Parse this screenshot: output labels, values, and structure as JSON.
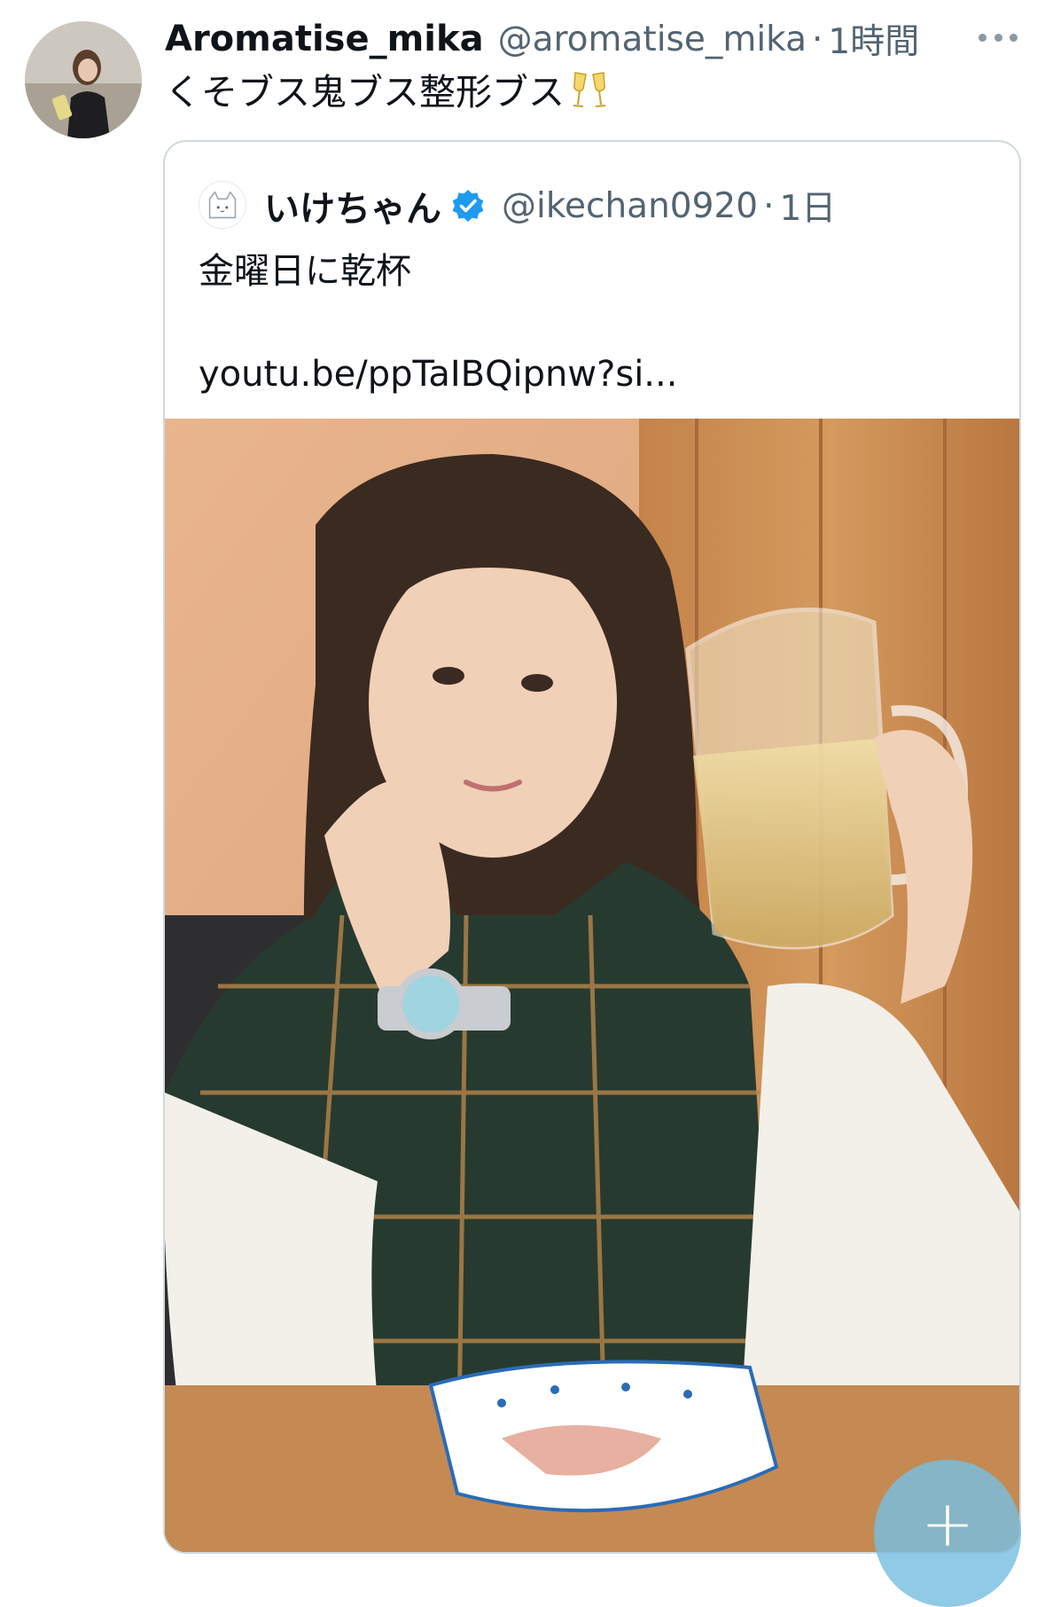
{
  "tweet": {
    "display_name": "Aromatise_mika",
    "handle": "@aromatise_mika",
    "separator": "·",
    "time": "1時間",
    "text": "くそブス鬼ブス整形ブス",
    "emoji_icon": "clinking-glasses-icon",
    "more_icon": "more-horizontal-icon"
  },
  "quote": {
    "display_name": "いけちゃん",
    "verified_icon": "verified-badge-icon",
    "verified_color": "#1d9bf0",
    "handle": "@ikechan0920",
    "separator": "·",
    "time": "1日",
    "text": "金曜日に乾杯",
    "link": "youtu.be/ppTaIBQipnw?si..."
  },
  "fab": {
    "label": "+",
    "icon": "compose-plus-icon"
  },
  "colors": {
    "text_primary": "#0f1419",
    "text_secondary": "#536471",
    "border": "#cfd9de",
    "fab": "#78bee1"
  }
}
